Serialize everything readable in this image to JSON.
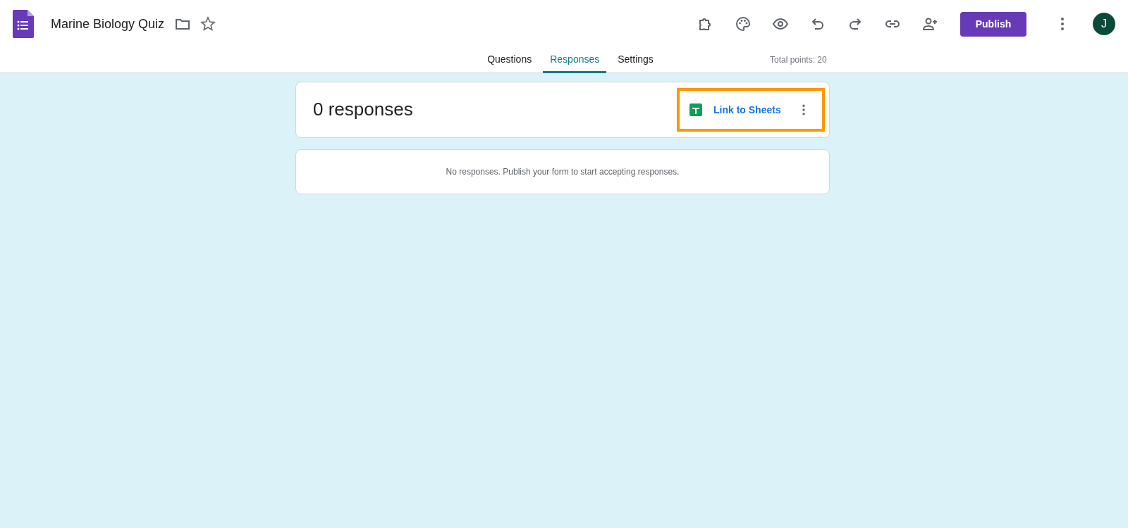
{
  "header": {
    "title": "Marine Biology Quiz",
    "publish_label": "Publish",
    "avatar_initial": "J"
  },
  "tabs": [
    {
      "label": "Questions",
      "selected": false
    },
    {
      "label": "Responses",
      "selected": true
    },
    {
      "label": "Settings",
      "selected": false
    }
  ],
  "total_points": "Total points: 20",
  "summary": {
    "title": "0 responses",
    "link_label": "Link to Sheets",
    "highlighted": true
  },
  "empty_message": "No responses. Publish your form to start accepting responses."
}
